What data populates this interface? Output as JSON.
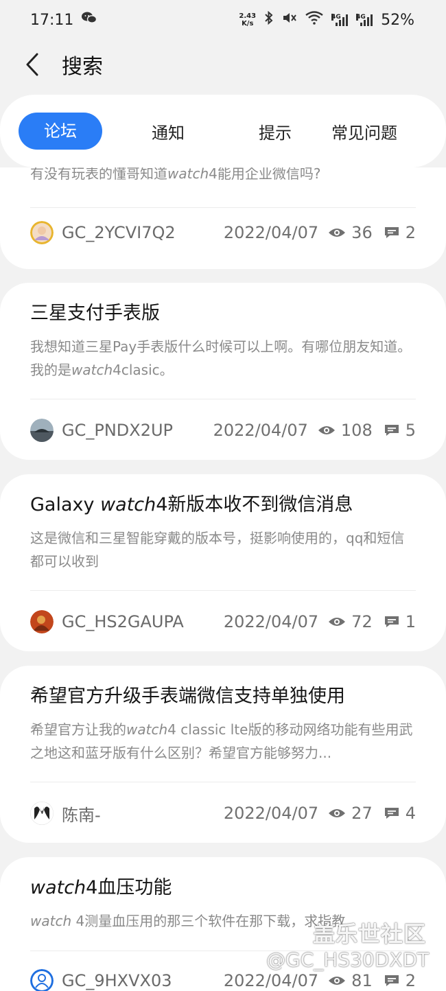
{
  "status_bar": {
    "time": "17:11",
    "speed_value": "2.43",
    "speed_unit": "K/s",
    "net1": "4G",
    "net2": "4G",
    "battery": "52%"
  },
  "header": {
    "title": "搜索"
  },
  "tabs": [
    {
      "label": "论坛",
      "active": true
    },
    {
      "label": "通知",
      "active": false
    },
    {
      "label": "提示",
      "active": false
    },
    {
      "label": "常见问题",
      "active": false
    }
  ],
  "posts": [
    {
      "title": "",
      "excerpt_pre": "有没有玩表的懂哥知道",
      "excerpt_italic": "watch",
      "excerpt_post": "4能用企业微信吗?",
      "author": "GC_2YCVI7Q2",
      "date": "2022/04/07",
      "views": "36",
      "comments": "2"
    },
    {
      "title": "三星支付手表版",
      "excerpt_pre": "我想知道三星Pay手表版什么时候可以上啊。有哪位朋友知道。我的是",
      "excerpt_italic": "watch",
      "excerpt_post": "4clasic。",
      "author": "GC_PNDX2UP",
      "date": "2022/04/07",
      "views": "108",
      "comments": "5"
    },
    {
      "title_pre": "Galaxy ",
      "title_italic": "watch",
      "title_post": "4新版本收不到微信消息",
      "excerpt": "这是微信和三星智能穿戴的版本号，挺影响使用的，qq和短信都可以收到",
      "author": "GC_HS2GAUPA",
      "date": "2022/04/07",
      "views": "72",
      "comments": "1"
    },
    {
      "title": "希望官方升级手表端微信支持单独使用",
      "excerpt_pre": "希望官方让我的",
      "excerpt_italic": "watch",
      "excerpt_post": "4 classic lte版的移动网络功能有些用武之地这和蓝牙版有什么区别？希望官方能够努力...",
      "author": "陈南-",
      "date": "2022/04/07",
      "views": "27",
      "comments": "4"
    },
    {
      "title_italic": "watch",
      "title_post": "4血压功能",
      "excerpt_italic": "watch",
      "excerpt_post": " 4测量血压用的那三个软件在那下载，求指教",
      "author": "GC_9HXVX03",
      "date": "2022/04/07",
      "views": "81",
      "comments": "2"
    }
  ],
  "watermark": {
    "line1": "盖乐世社区",
    "line2": "@GC_HS30DXDT"
  },
  "colors": {
    "accent": "#2a7df6",
    "background": "#f2f2f2",
    "card": "#ffffff",
    "meta_text": "#707070",
    "excerpt_text": "#8a8a8a"
  }
}
